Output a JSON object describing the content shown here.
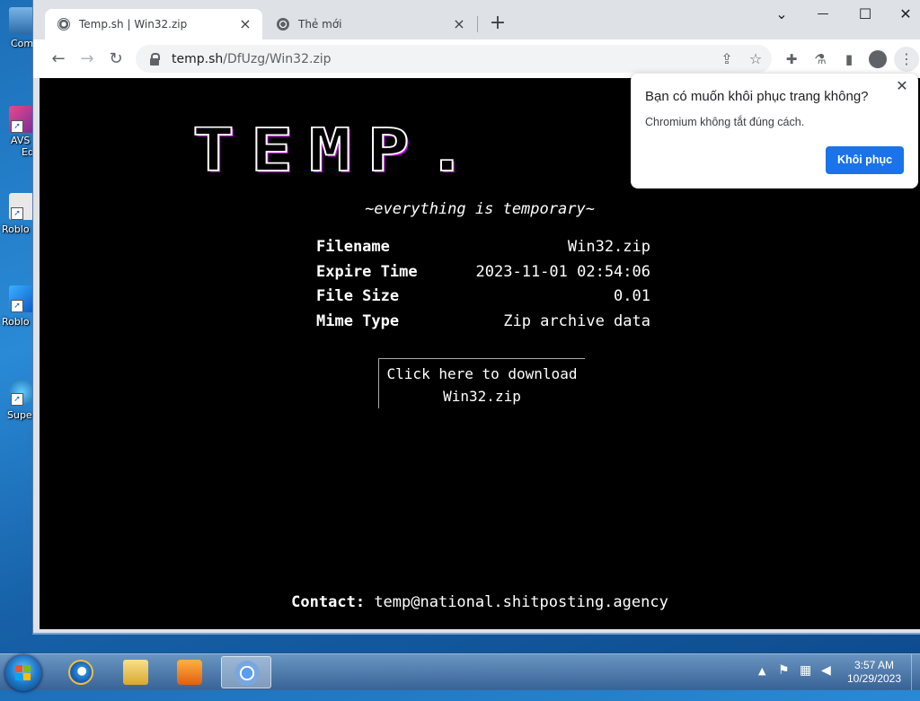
{
  "desktop": {
    "icons": [
      {
        "label": "Com",
        "icon": "computer-icon"
      },
      {
        "label": "AVS",
        "label2": "Ed",
        "icon": "avs-editor-icon"
      },
      {
        "label": "Roblo",
        "icon": "roblox-icon"
      },
      {
        "label": "Roblo",
        "icon": "roblox-studio-icon"
      },
      {
        "label": "Supe",
        "icon": "super-icon"
      }
    ]
  },
  "browser": {
    "tabs": [
      {
        "title": "Temp.sh | Win32.zip",
        "active": true
      },
      {
        "title": "Thẻ mới",
        "active": false
      }
    ],
    "new_tab": "+",
    "window_controls": {
      "collapse": "⌄",
      "minimize": "—",
      "maximize": "☐",
      "close": "✕"
    },
    "url_host": "temp.sh",
    "url_path": "/DfUzg/Win32.zip"
  },
  "page": {
    "logo": "TEMP.",
    "tagline": "~everything is temporary~",
    "info": [
      {
        "key": "Filename",
        "value": "Win32.zip"
      },
      {
        "key": "Expire Time",
        "value": "2023-11-01 02:54:06"
      },
      {
        "key": "File Size",
        "value": "0.01"
      },
      {
        "key": "Mime Type",
        "value": "Zip archive data"
      }
    ],
    "download_line1": "Click here to download",
    "download_line2": "Win32.zip",
    "contact_label": "Contact:",
    "contact_email": "temp@national.shitposting.agency"
  },
  "restore_popup": {
    "title": "Bạn có muốn khôi phục trang không?",
    "body": "Chromium không tắt đúng cách.",
    "button": "Khôi phục",
    "close": "✕"
  },
  "taskbar": {
    "apps": [
      "internet-explorer-icon",
      "file-explorer-icon",
      "media-player-icon",
      "chromium-icon"
    ],
    "time": "3:57 AM",
    "date": "10/29/2023"
  },
  "colors": {
    "accent_button": "#1a73e8",
    "page_bg": "#000000",
    "desktop_bg": "#1d6fb8"
  }
}
